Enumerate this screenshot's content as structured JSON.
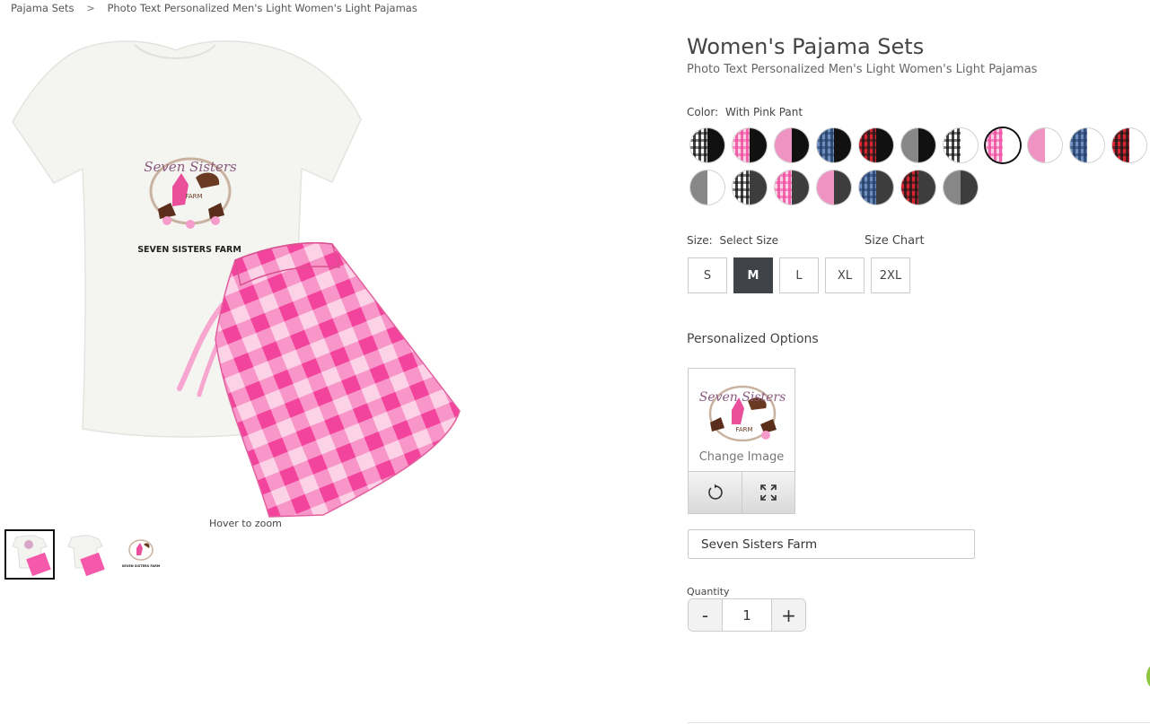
{
  "breadcrumb": {
    "items": [
      "Pajama Sets",
      "Photo Text Personalized Men's Light Women's Light Pajamas"
    ],
    "separator": ">"
  },
  "gallery": {
    "hover_hint": "Hover to zoom",
    "design_text": "SEVEN SISTERS FARM",
    "logo_line1": "Seven Sisters",
    "logo_line2": "FARM",
    "thumb_caption": "SEVEN SISTERS FARM"
  },
  "product": {
    "title": "Women's Pajama Sets",
    "subtitle": "Photo Text Personalized Men's Light Women's Light Pajamas"
  },
  "color": {
    "label": "Color:",
    "selected": "With Pink Pant",
    "swatches": [
      {
        "left": "#ffffff",
        "right": "#111111",
        "pattern": "plaid-bw"
      },
      {
        "left": "#f06ab4",
        "right": "#111111",
        "pattern": "plaid-pink"
      },
      {
        "left": "#ee8fc0",
        "right": "#111111",
        "pattern": "solid-pink"
      },
      {
        "left": "#3b5a8a",
        "right": "#111111",
        "pattern": "plaid-blue"
      },
      {
        "left": "#c41e2a",
        "right": "#111111",
        "pattern": "plaid-red"
      },
      {
        "left": "#8a8a8a",
        "right": "#111111",
        "pattern": "solid-gray"
      },
      {
        "left": "#555555",
        "right": "#ffffff",
        "pattern": "plaid-bw"
      },
      {
        "left": "#f06ab4",
        "right": "#ffffff",
        "pattern": "plaid-pink",
        "selected": true
      },
      {
        "left": "#ee8fc0",
        "right": "#ffffff",
        "pattern": "solid-pink"
      },
      {
        "left": "#3b5a8a",
        "right": "#ffffff",
        "pattern": "plaid-blue"
      },
      {
        "left": "#c41e2a",
        "right": "#ffffff",
        "pattern": "plaid-red"
      },
      {
        "left": "#8a8a8a",
        "right": "#ffffff",
        "pattern": "solid-gray"
      },
      {
        "left": "#555555",
        "right": "#3d3d3d",
        "pattern": "plaid-bw"
      },
      {
        "left": "#f06ab4",
        "right": "#3d3d3d",
        "pattern": "plaid-pink"
      },
      {
        "left": "#ee8fc0",
        "right": "#3d3d3d",
        "pattern": "solid-pink"
      },
      {
        "left": "#3b5a8a",
        "right": "#3d3d3d",
        "pattern": "plaid-blue"
      },
      {
        "left": "#c41e2a",
        "right": "#3d3d3d",
        "pattern": "plaid-red"
      },
      {
        "left": "#8a8a8a",
        "right": "#3d3d3d",
        "pattern": "solid-gray"
      }
    ]
  },
  "size": {
    "label": "Size:",
    "selected": "Select Size",
    "chart_link": "Size Chart",
    "options": [
      "S",
      "M",
      "L",
      "XL",
      "2XL"
    ],
    "active": "M"
  },
  "personalize": {
    "heading": "Personalized Options",
    "change_image": "Change Image",
    "text_value": "Seven Sisters Farm"
  },
  "quantity": {
    "label": "Quantity",
    "minus": "-",
    "plus": "+",
    "value": "1"
  },
  "colors": {
    "pink": "#f45aa9",
    "light_pink": "#f9a8d0",
    "selected_size_bg": "#404448",
    "help_green": "#8dc63f"
  }
}
